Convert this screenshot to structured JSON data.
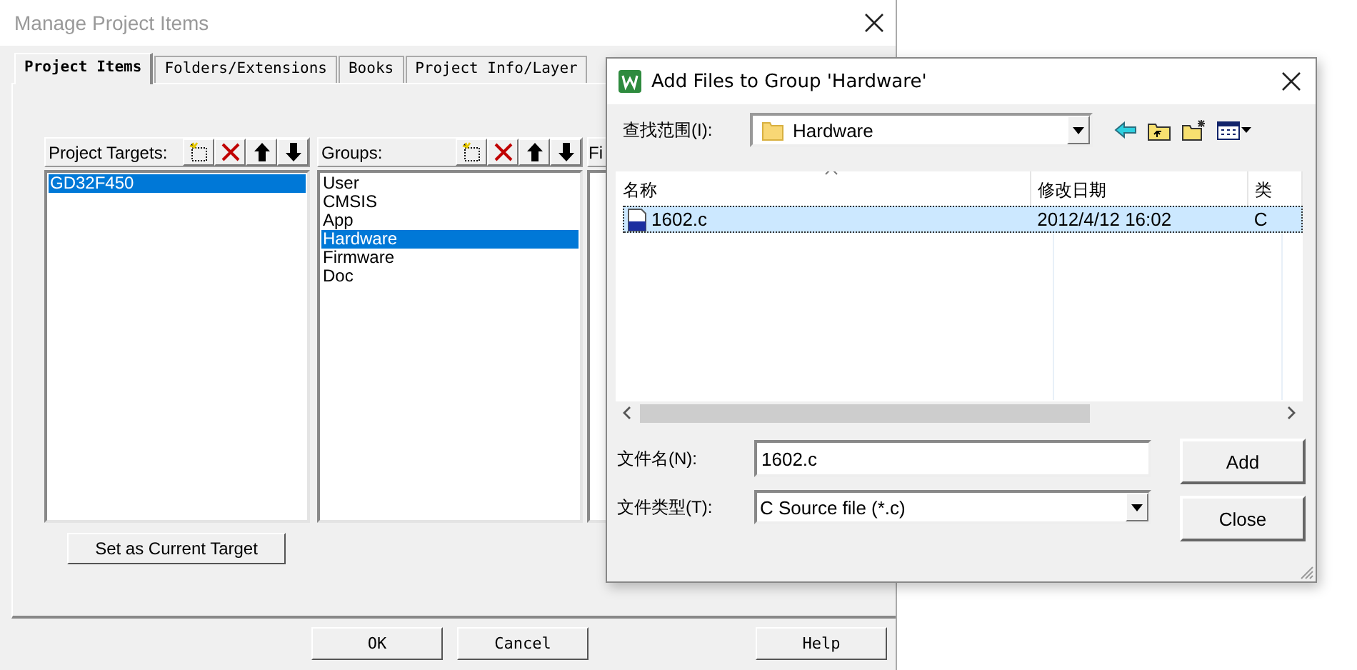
{
  "manage_dialog": {
    "title": "Manage Project Items",
    "tabs": [
      {
        "label": "Project Items",
        "selected": true
      },
      {
        "label": "Folders/Extensions",
        "selected": false
      },
      {
        "label": "Books",
        "selected": false
      },
      {
        "label": "Project Info/Layer",
        "selected": false
      }
    ],
    "targets": {
      "label": "Project Targets:",
      "items": [
        {
          "label": "GD32F450",
          "selected": true
        }
      ]
    },
    "groups": {
      "label": "Groups:",
      "items": [
        {
          "label": "User",
          "selected": false
        },
        {
          "label": "CMSIS",
          "selected": false
        },
        {
          "label": "App",
          "selected": false
        },
        {
          "label": "Hardware",
          "selected": true
        },
        {
          "label": "Firmware",
          "selected": false
        },
        {
          "label": "Doc",
          "selected": false
        }
      ]
    },
    "files_label": "Fi",
    "set_target_button": "Set as Current Target",
    "buttons": [
      "OK",
      "Cancel",
      "Help"
    ]
  },
  "add_files_dialog": {
    "title": "Add Files to Group 'Hardware'",
    "look_in": {
      "label": "查找范围(I):",
      "value": "Hardware"
    },
    "columns": [
      "名称",
      "修改日期",
      "类"
    ],
    "rows": [
      {
        "cells": [
          "1602.c",
          "2012/4/12 16:02",
          "C"
        ],
        "selected": true
      }
    ],
    "file_name": {
      "label": "文件名(N):",
      "value": "1602.c"
    },
    "file_type": {
      "label": "文件类型(T):",
      "value": "C Source file (*.c)"
    },
    "buttons": [
      "Add",
      "Close"
    ]
  }
}
